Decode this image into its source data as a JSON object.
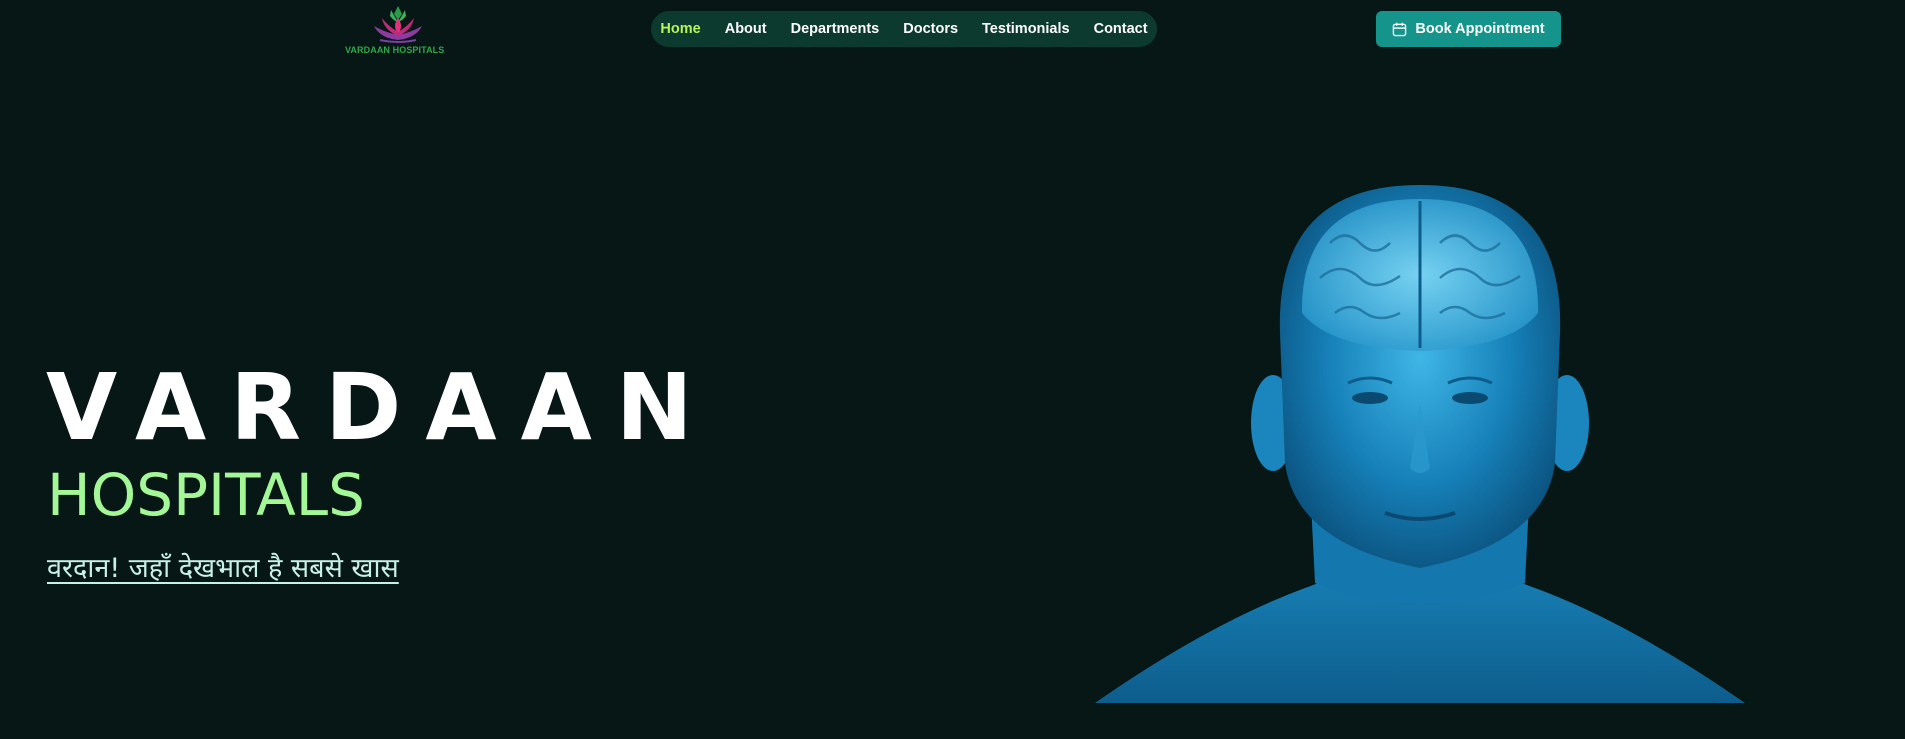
{
  "logo": {
    "text": "VARDAAN HOSPITALS"
  },
  "nav": {
    "items": [
      {
        "label": "Home",
        "active": true
      },
      {
        "label": "About"
      },
      {
        "label": "Departments"
      },
      {
        "label": "Doctors"
      },
      {
        "label": "Testimonials"
      },
      {
        "label": "Contact"
      }
    ]
  },
  "cta": {
    "label": "Book Appointment",
    "icon": "calendar-icon"
  },
  "hero": {
    "title": "VARDAAN",
    "subtitle": "HOSPITALS",
    "tagline": "वरदान! जहाँ देखभाल है सबसे खास",
    "image": "glowing-blue-human-head-brain"
  },
  "colors": {
    "background": "#061715",
    "nav_bg": "#0c3a2e",
    "nav_active": "#b6f45a",
    "button_bg": "#14948a",
    "subtitle": "#a3f797",
    "tagline": "#c8f1e6"
  }
}
